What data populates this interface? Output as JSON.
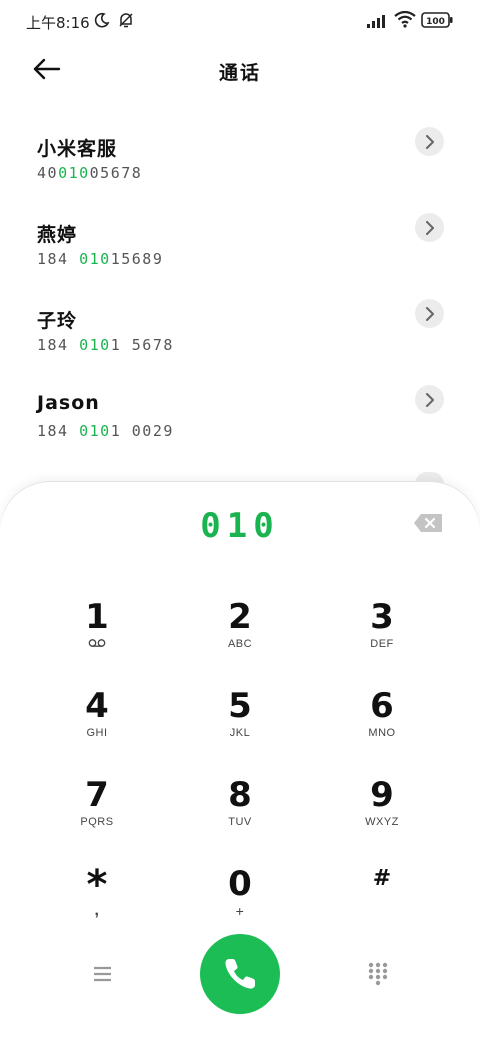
{
  "status_bar": {
    "time": "上午8:16",
    "icons": [
      "moon-icon",
      "muted-bell-icon",
      "signal-icon",
      "wifi-icon",
      "battery-icon"
    ],
    "battery": "100"
  },
  "header": {
    "title": "通话",
    "back_icon": "arrow-left-icon"
  },
  "contacts": [
    {
      "name": "小米客服",
      "number_pre": "40",
      "number_match": "010",
      "number_post": "05678"
    },
    {
      "name": "燕婷",
      "number_pre": "184 ",
      "number_match": "010",
      "number_post": "15689"
    },
    {
      "name": "子玲",
      "number_pre": "184 ",
      "number_match": "010",
      "number_post": "1 5678"
    },
    {
      "name": "Jason",
      "number_pre": "184 ",
      "number_match": "010",
      "number_post": "1 0029"
    }
  ],
  "dialer": {
    "input": "010",
    "keys": [
      {
        "digit": "1",
        "letters": ""
      },
      {
        "digit": "2",
        "letters": "ABC"
      },
      {
        "digit": "3",
        "letters": "DEF"
      },
      {
        "digit": "4",
        "letters": "GHI"
      },
      {
        "digit": "5",
        "letters": "JKL"
      },
      {
        "digit": "6",
        "letters": "MNO"
      },
      {
        "digit": "7",
        "letters": "PQRS"
      },
      {
        "digit": "8",
        "letters": "TUV"
      },
      {
        "digit": "9",
        "letters": "WXYZ"
      },
      {
        "digit": "*",
        "letters": ","
      },
      {
        "digit": "0",
        "letters": "+"
      },
      {
        "digit": "#",
        "letters": ""
      }
    ]
  },
  "colors": {
    "accent_green": "#19b34f",
    "call_button": "#1dbd56",
    "chevron_bg": "#ececec"
  }
}
